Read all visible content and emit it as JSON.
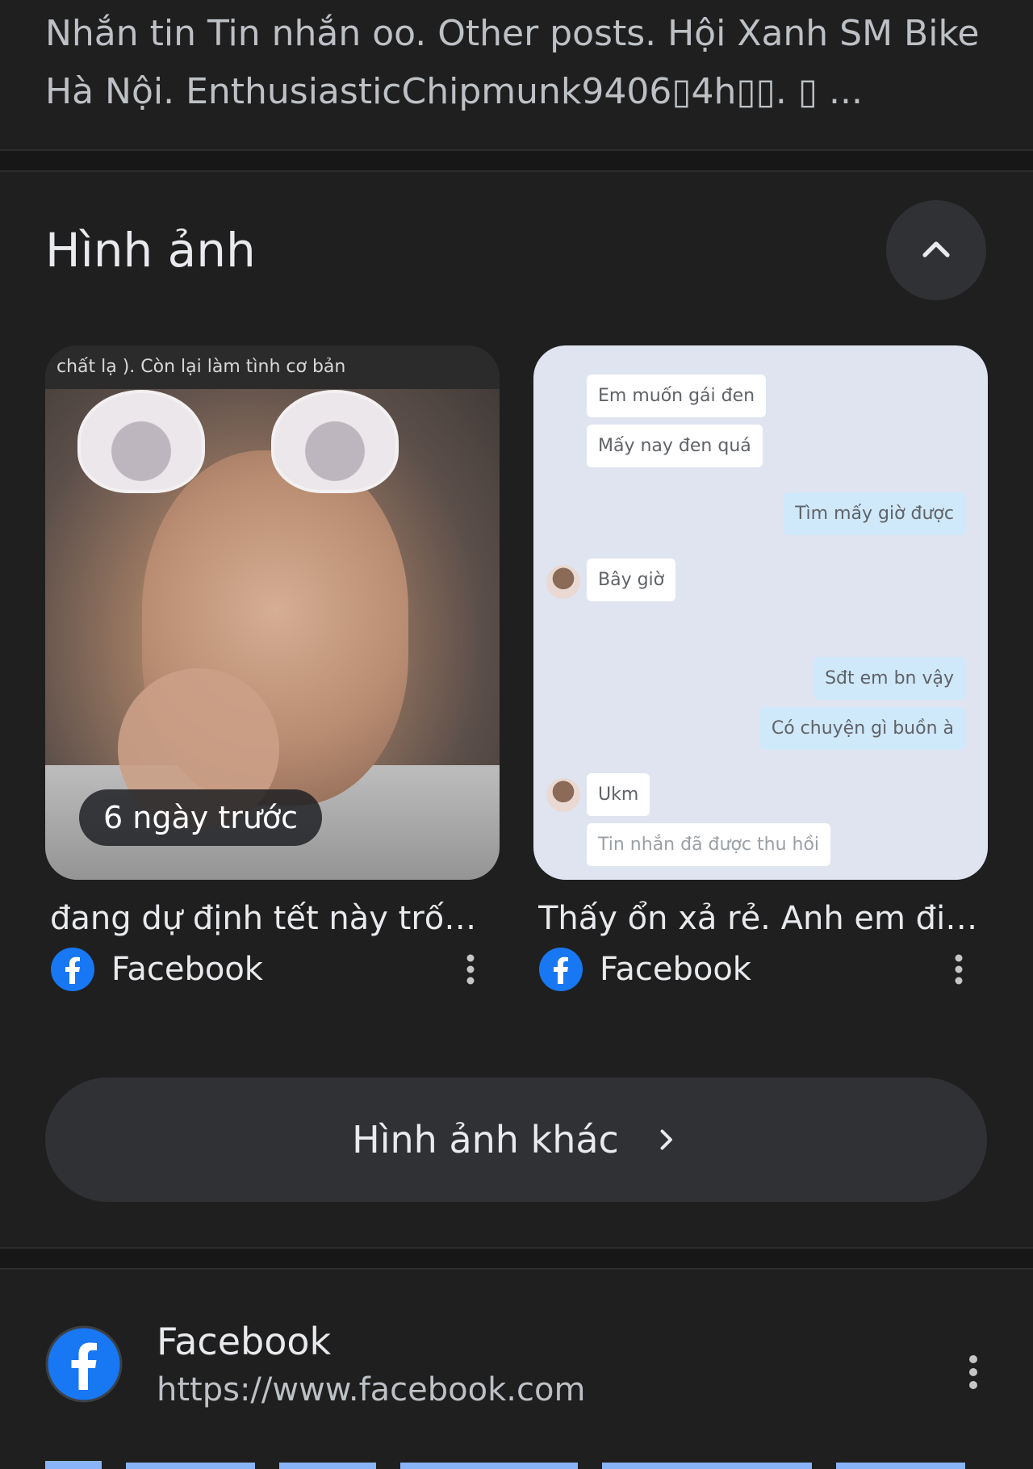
{
  "snippet_text": "Nhắn tin Tin nhắn oo. Other posts. Hội Xanh SM Bike Hà Nội. EnthusiasticChipmunk9406▯4h▯▯. ▯ ...",
  "images_section": {
    "title": "Hình ảnh",
    "collapse_icon": "chevron-up-icon",
    "cards": [
      {
        "badge": "6 ngày trước",
        "image_caption_text": "chất lạ ). Còn lại làm tình cơ bản",
        "title": "đang dự định tết này trốn ...",
        "source": "Facebook"
      },
      {
        "title": "Thấy ổn xả rẻ. Anh em đi t...",
        "source": "Facebook",
        "chat": {
          "in1": "Em muốn gái đen",
          "in2": "Mấy nay đen quá",
          "out1": "Tìm mấy giờ được",
          "in3": "Bây giờ",
          "out2": "Sđt em bn vậy",
          "out3": "Có chuyện gì buồn à",
          "in4": "Ukm",
          "recalled": "Tin nhắn đã được thu hồi"
        }
      }
    ],
    "more_button": "Hình ảnh khác"
  },
  "result": {
    "site_name": "Facebook",
    "url": "https://www.facebook.com"
  },
  "colors": {
    "background": "#1f1f1f",
    "facebook_blue": "#1877f2",
    "link_blue": "#8ab4f8"
  }
}
